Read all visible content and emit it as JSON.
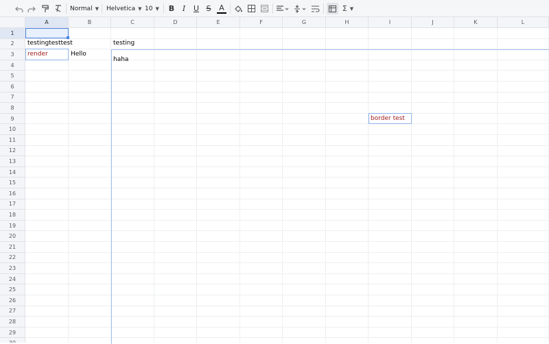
{
  "toolbar": {
    "paragraph_style": "Normal",
    "font_family": "Helvetica",
    "font_size": "10",
    "icons": [
      "undo-icon",
      "redo-icon",
      "paint-format-icon",
      "clear-format-icon",
      "bold-icon",
      "italic-icon",
      "underline-icon",
      "strikethrough-icon",
      "text-color-icon",
      "fill-color-icon",
      "borders-icon",
      "merge-cells-icon",
      "align-icon",
      "valign-icon",
      "wrap-icon",
      "freeze-icon",
      "formula-icon"
    ],
    "bold_label": "B",
    "italic_label": "I",
    "underline_label": "U",
    "strike_label": "S",
    "text_color_label": "A",
    "sum_label": "Σ"
  },
  "grid": {
    "columns": [
      "A",
      "B",
      "C",
      "D",
      "E",
      "F",
      "G",
      "H",
      "I",
      "J",
      "K",
      "L"
    ],
    "rows": [
      "1",
      "2",
      "3",
      "4",
      "5",
      "6",
      "7",
      "8",
      "9",
      "10",
      "11",
      "12",
      "13",
      "14",
      "15",
      "16",
      "17",
      "18",
      "19",
      "20",
      "21",
      "22",
      "23",
      "24",
      "25",
      "26",
      "27",
      "28",
      "29",
      "30"
    ],
    "selected_cell": "A1"
  },
  "cells": {
    "a2": "testingtesttest",
    "c2": "testing",
    "a3": "render",
    "b3": "Hello",
    "c3": "haha",
    "i9": "border test"
  },
  "colors": {
    "accent": "#4a84e0",
    "red_text": "#9c1818",
    "header_bg": "#f4f5f8"
  }
}
